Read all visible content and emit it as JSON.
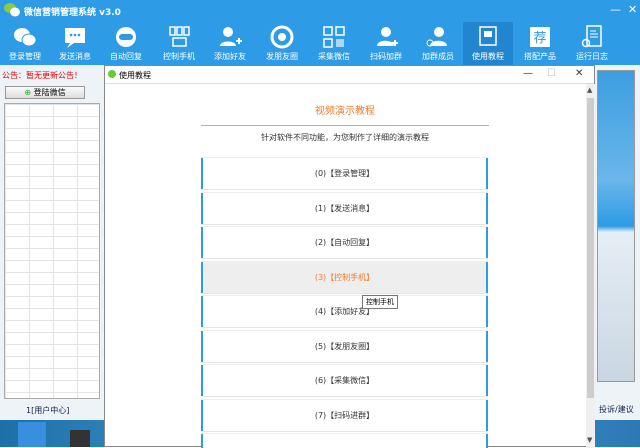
{
  "app": {
    "title": "微信营销管理系统 v3.0",
    "minimize": "—",
    "close": "✕"
  },
  "toolbar": [
    {
      "label": "登录管理",
      "icon": "wechat-icon"
    },
    {
      "label": "发送消息",
      "icon": "message-icon"
    },
    {
      "label": "自动回复",
      "icon": "robot-icon"
    },
    {
      "label": "控制手机",
      "icon": "devices-icon"
    },
    {
      "label": "添加好友",
      "icon": "add-user-icon"
    },
    {
      "label": "发朋友圈",
      "icon": "aperture-icon"
    },
    {
      "label": "采集微信",
      "icon": "qrcode-icon"
    },
    {
      "label": "扫码加群",
      "icon": "group-add-icon"
    },
    {
      "label": "加群成员",
      "icon": "group-members-icon"
    },
    {
      "label": "使用教程",
      "icon": "tutorial-icon",
      "active": true
    },
    {
      "label": "搭配产品",
      "icon": "product-icon"
    },
    {
      "label": "运行日志",
      "icon": "log-icon"
    }
  ],
  "left": {
    "notice": "公告：暂无更新公告！",
    "login_button": "登陆微信",
    "status": "1[用户中心]"
  },
  "right": {
    "status": "投诉/建议"
  },
  "dialog": {
    "title": "使用教程",
    "minimize": "—",
    "maximize": "☐",
    "close": "✕",
    "heading": "视频演示教程",
    "subtitle": "针对软件不同功能，为您制作了详细的演示教程",
    "items": [
      "(0)【登录管理】",
      "(1)【发送消息】",
      "(2)【自动回复】",
      "(3)【控制手机】",
      "(4)【添加好友】",
      "(5)【发朋友圈】",
      "(6)【采集微信】",
      "(7)【扫码进群】",
      ""
    ],
    "tooltip": "控制手机"
  },
  "colors": {
    "brand": "#2d9be6",
    "accent": "#f07c30"
  }
}
